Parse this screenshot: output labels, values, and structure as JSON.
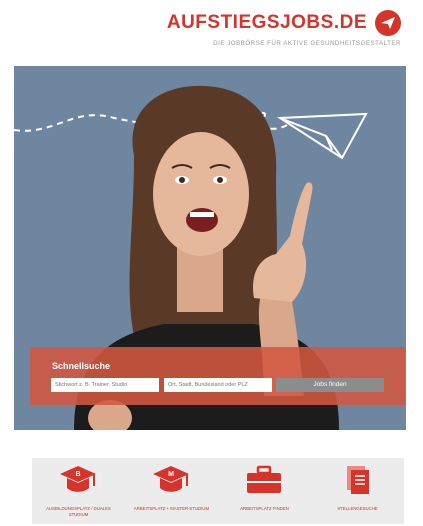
{
  "brand": {
    "name": "AUFSTIEGSJOBS.DE",
    "tagline": "DIE JOBBÖRSE FÜR AKTIVE GESUNDHEITSGESTALTER",
    "accent": "#d6332b"
  },
  "hero": {
    "background": "#6f86a1"
  },
  "quick_search": {
    "title": "Schnellsuche",
    "keyword_placeholder": "Stichwort z. B. Trainer, Studio",
    "location_placeholder": "Ort, Stadt, Bundesland oder PLZ",
    "button": "Jobs finden"
  },
  "categories": [
    {
      "label": "AUSBILDUNGSPLATZ / DUALES STUDIUM",
      "icon": "grad-cap-b-icon"
    },
    {
      "label": "ARBEITSPLATZ + MASTER-STUDIUM",
      "icon": "grad-cap-m-icon"
    },
    {
      "label": "ARBEITSPLATZ FINDEN",
      "icon": "briefcase-icon"
    },
    {
      "label": "STELLENGESUCHE",
      "icon": "documents-icon"
    }
  ]
}
